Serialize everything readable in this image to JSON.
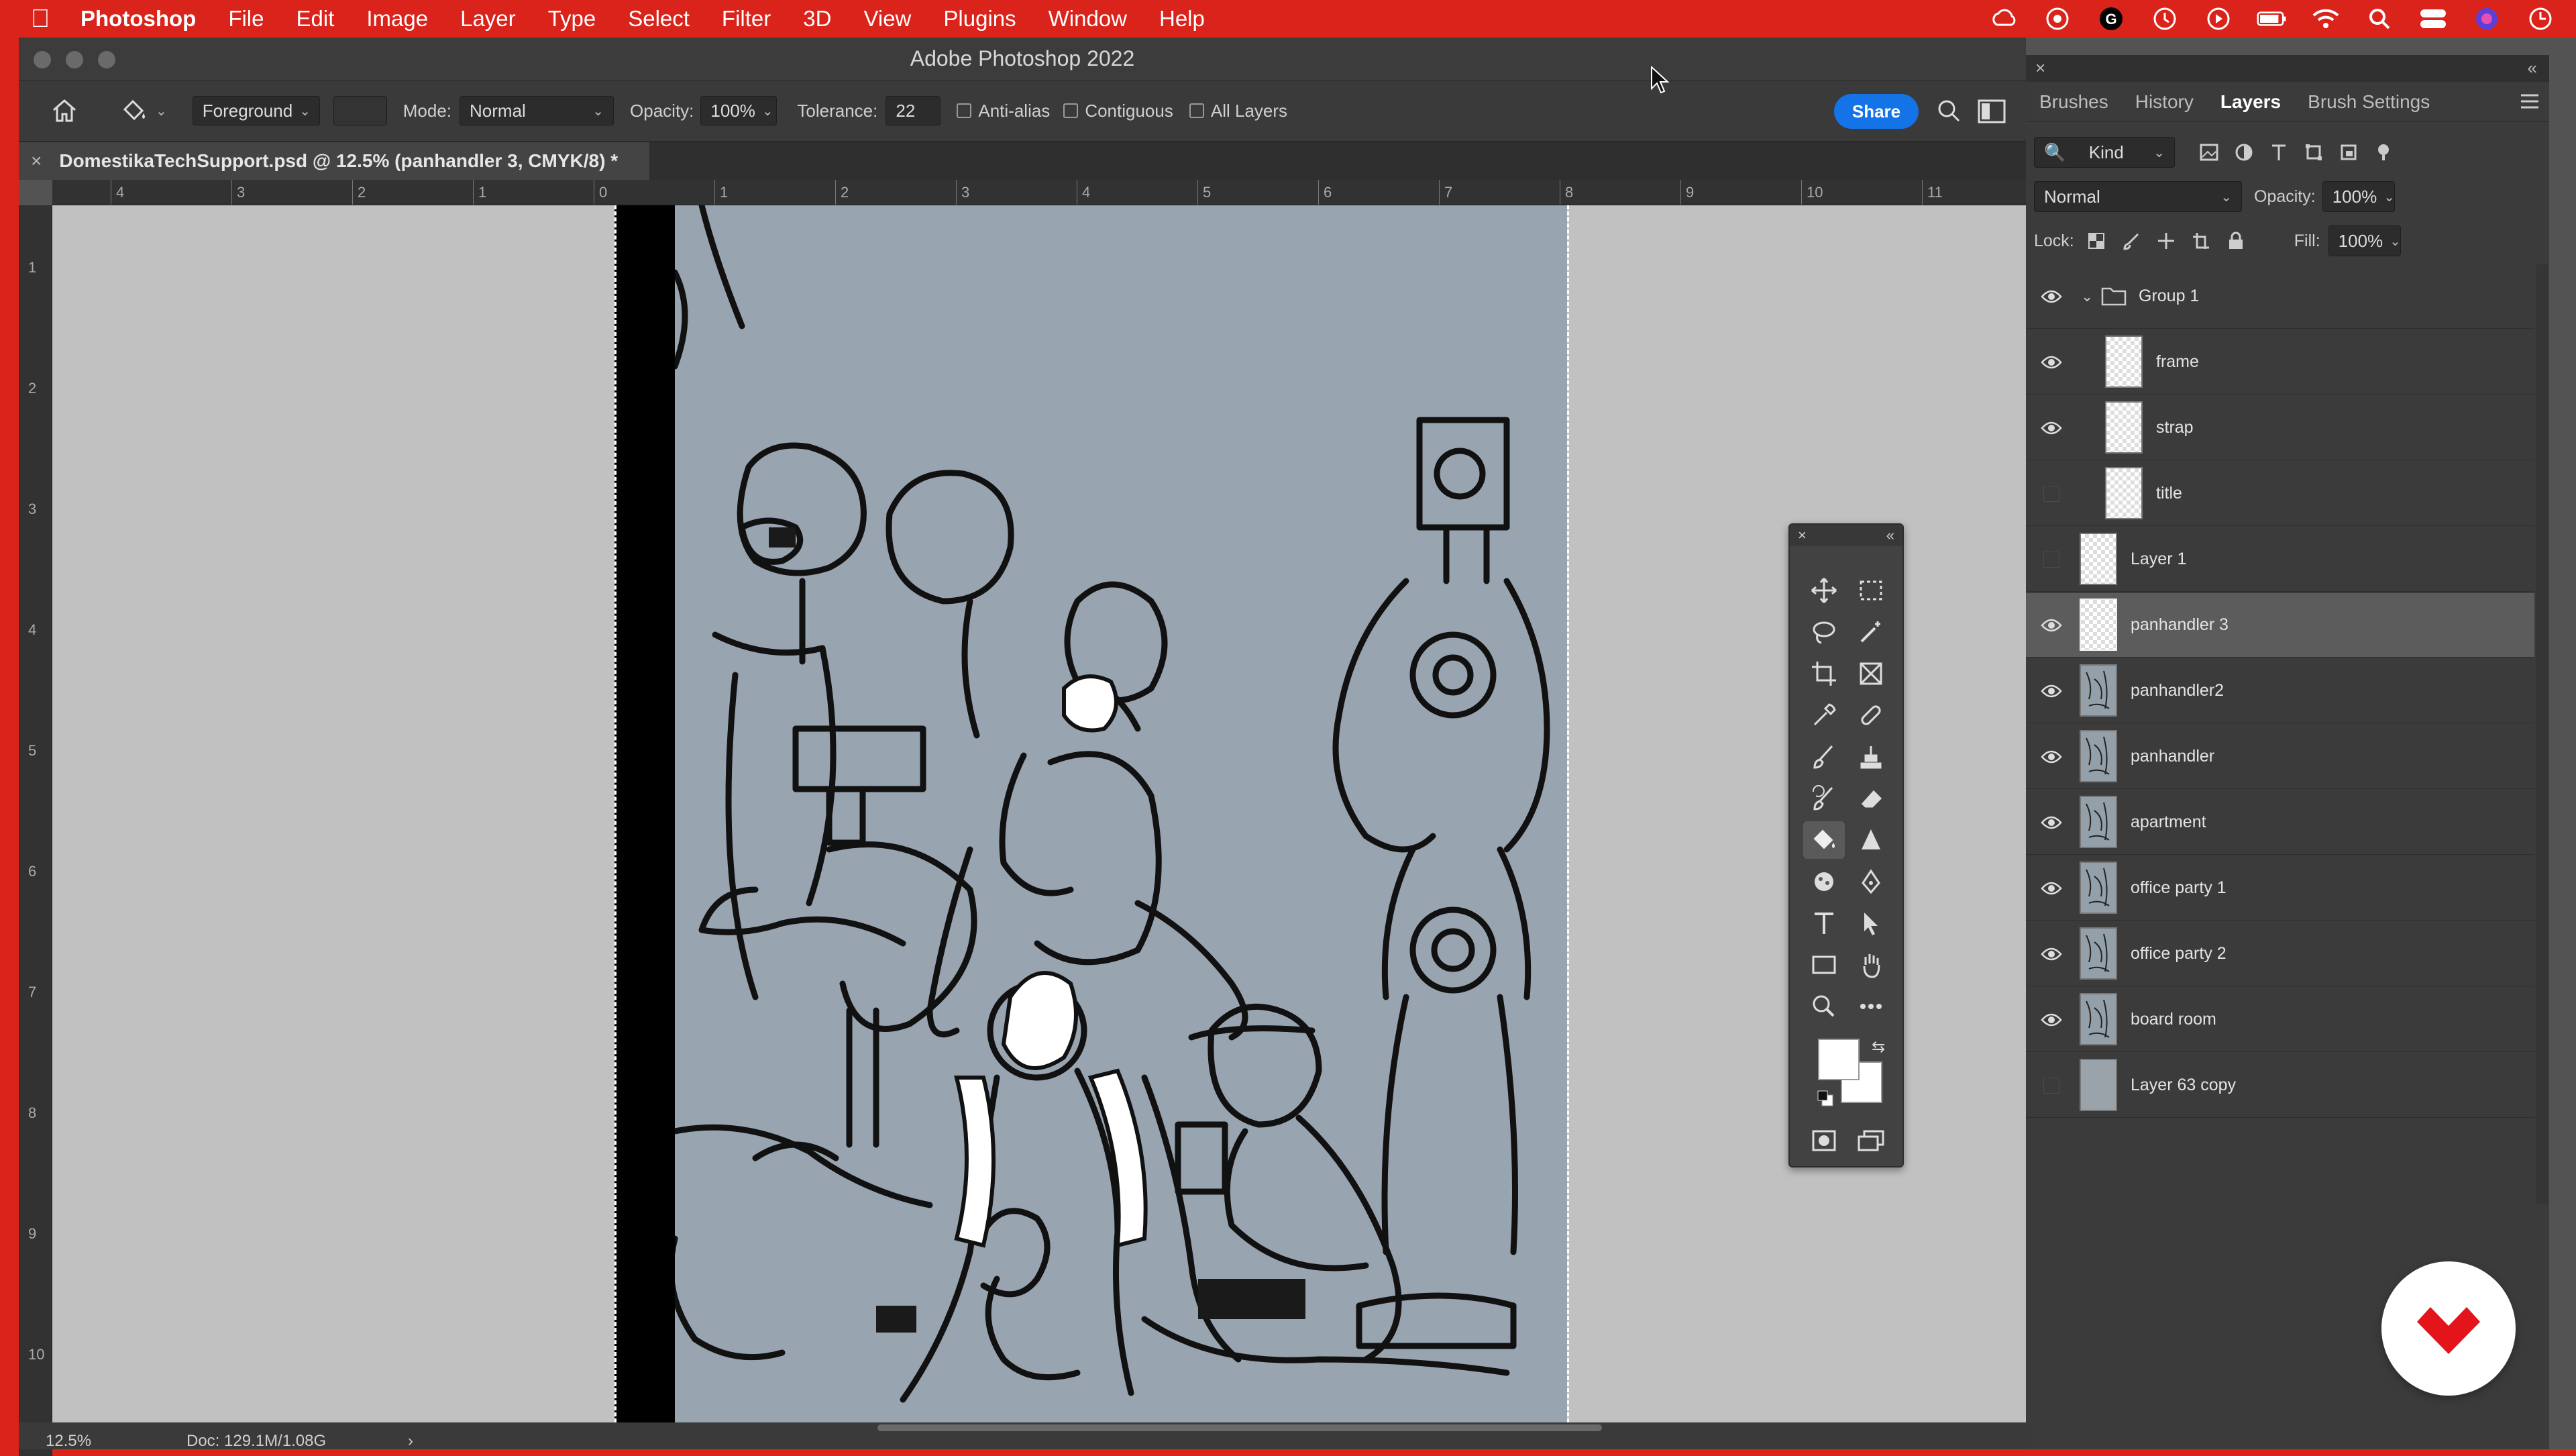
{
  "menubar": {
    "app_name": "Photoshop",
    "items": [
      "File",
      "Edit",
      "Image",
      "Layer",
      "Type",
      "Select",
      "Filter",
      "3D",
      "View",
      "Plugins",
      "Window",
      "Help"
    ]
  },
  "window": {
    "title": "Adobe Photoshop 2022"
  },
  "options_bar": {
    "fill_source": "Foreground",
    "mode_label": "Mode:",
    "mode_value": "Normal",
    "opacity_label": "Opacity:",
    "opacity_value": "100%",
    "tolerance_label": "Tolerance:",
    "tolerance_value": "22",
    "anti_alias_label": "Anti-alias",
    "contiguous_label": "Contiguous",
    "all_layers_label": "All Layers",
    "share_label": "Share"
  },
  "document": {
    "tab_close": "×",
    "tab_title": "DomestikaTechSupport.psd @ 12.5% (panhandler 3, CMYK/8) *"
  },
  "rulers": {
    "top_labels": [
      "4",
      "3",
      "2",
      "1",
      "0",
      "1",
      "2",
      "3",
      "4",
      "5",
      "6",
      "7",
      "8",
      "9",
      "10",
      "11"
    ],
    "left_labels": [
      "1",
      "2",
      "3",
      "4",
      "5",
      "6",
      "7",
      "8",
      "9",
      "10"
    ]
  },
  "status": {
    "zoom": "12.5%",
    "doc_size": "Doc: 129.1M/1.08G",
    "arrow": "›"
  },
  "panel": {
    "tabs": [
      "Brushes",
      "History",
      "Layers",
      "Brush Settings"
    ],
    "active_tab": "Layers",
    "filter_kind": "Kind",
    "blend_mode": "Normal",
    "opacity_label": "Opacity:",
    "opacity_value": "100%",
    "lock_label": "Lock:",
    "fill_label": "Fill:",
    "fill_value": "100%"
  },
  "layers": [
    {
      "name": "Group 1",
      "visible": true,
      "kind": "group"
    },
    {
      "name": "frame",
      "visible": true,
      "kind": "child"
    },
    {
      "name": "strap",
      "visible": true,
      "kind": "child"
    },
    {
      "name": "title",
      "visible": false,
      "kind": "child"
    },
    {
      "name": "Layer 1",
      "visible": false,
      "kind": "layer"
    },
    {
      "name": "panhandler 3",
      "visible": true,
      "kind": "layer",
      "selected": true
    },
    {
      "name": "panhandler2",
      "visible": true,
      "kind": "art"
    },
    {
      "name": "panhandler",
      "visible": true,
      "kind": "art"
    },
    {
      "name": "apartment",
      "visible": true,
      "kind": "art"
    },
    {
      "name": "office party  1",
      "visible": true,
      "kind": "art"
    },
    {
      "name": "office party 2",
      "visible": true,
      "kind": "art"
    },
    {
      "name": "board room",
      "visible": true,
      "kind": "art"
    },
    {
      "name": "Layer 63 copy",
      "visible": false,
      "kind": "plain"
    }
  ],
  "colors": {
    "desktop_red": "#d9231b",
    "artwork_gray": "#98a4af",
    "selection_blue": "#1473e6",
    "brand_red": "#e4141b"
  }
}
